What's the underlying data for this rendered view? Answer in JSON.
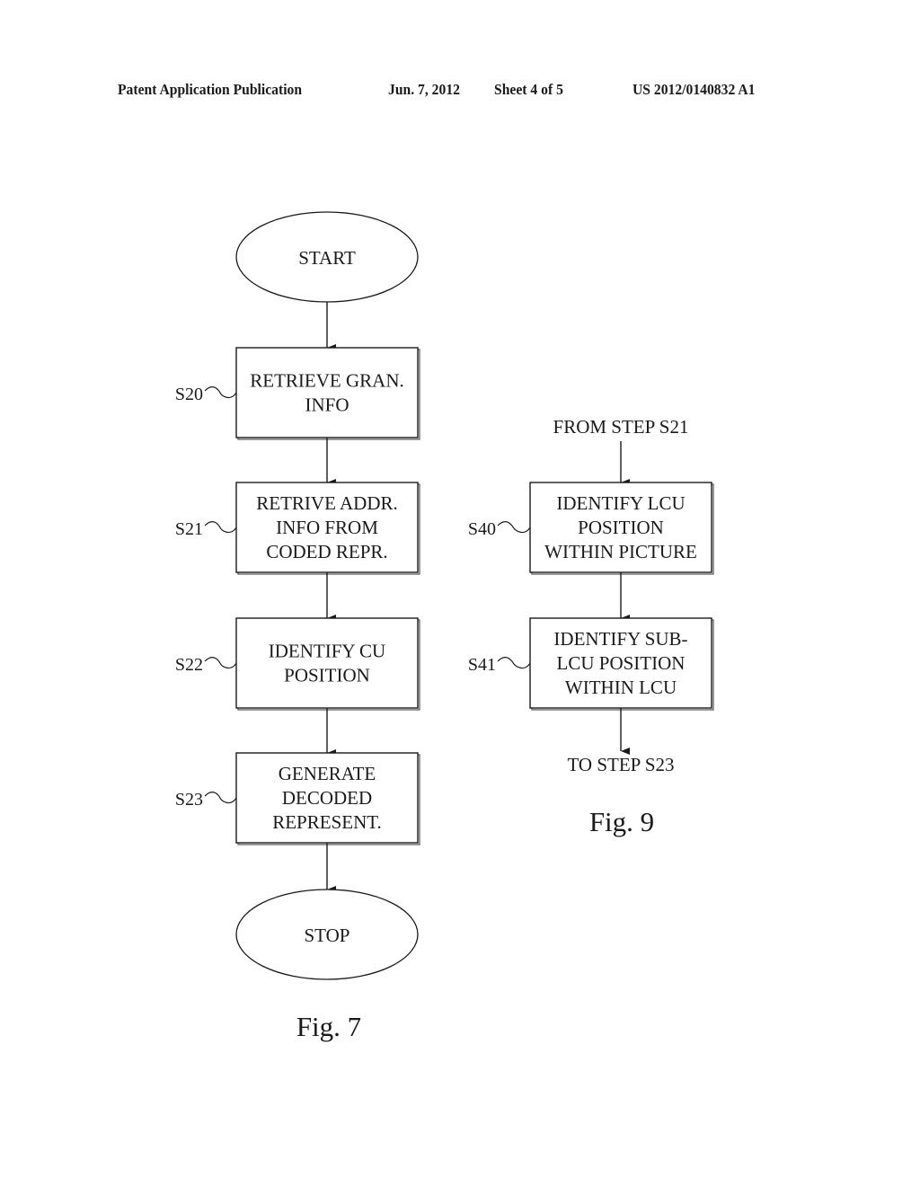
{
  "header": {
    "publication": "Patent Application Publication",
    "date": "Jun. 7, 2012",
    "sheet": "Sheet 4 of 5",
    "patent_number": "US 2012/0140832 A1"
  },
  "fig7": {
    "caption": "Fig. 7",
    "start": "START",
    "stop": "STOP",
    "steps": [
      {
        "id": "S20",
        "lines": [
          "RETRIEVE GRAN.",
          "INFO"
        ]
      },
      {
        "id": "S21",
        "lines": [
          "RETRIVE ADDR.",
          "INFO FROM",
          "CODED REPR."
        ]
      },
      {
        "id": "S22",
        "lines": [
          "IDENTIFY CU",
          "POSITION"
        ]
      },
      {
        "id": "S23",
        "lines": [
          "GENERATE",
          "DECODED",
          "REPRESENT."
        ]
      }
    ]
  },
  "fig9": {
    "caption": "Fig. 9",
    "entry": "FROM STEP S21",
    "exit": "TO STEP S23",
    "steps": [
      {
        "id": "S40",
        "lines": [
          "IDENTIFY LCU",
          "POSITION",
          "WITHIN PICTURE"
        ]
      },
      {
        "id": "S41",
        "lines": [
          "IDENTIFY SUB-",
          "LCU POSITION",
          "WITHIN LCU"
        ]
      }
    ]
  }
}
